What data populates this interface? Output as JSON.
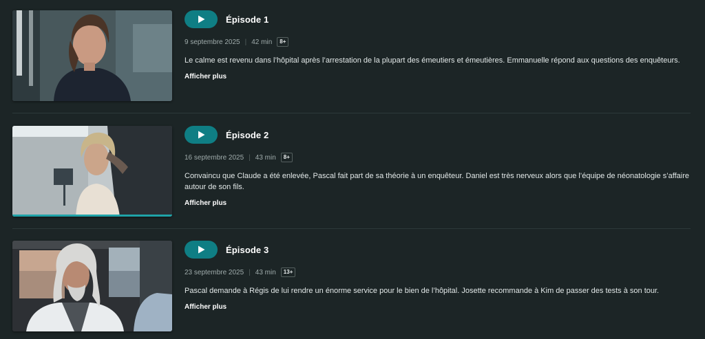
{
  "colors": {
    "background": "#1c2526",
    "accent": "#0f7e84",
    "progress": "#1fa3a8"
  },
  "episodes": [
    {
      "title": "Épisode 1",
      "date": "9 septembre 2025",
      "separator": "|",
      "duration": "42 min",
      "rating": "8+",
      "description": "Le calme est revenu dans l’hôpital après l’arrestation de la plupart des émeutiers et émeutières. Emmanuelle répond aux questions des enquêteurs.",
      "more_label": "Afficher plus",
      "play_icon": "play-icon",
      "watched_fraction": 0
    },
    {
      "title": "Épisode 2",
      "date": "16 septembre 2025",
      "separator": "|",
      "duration": "43 min",
      "rating": "8+",
      "description": "Convaincu que Claude a été enlevée, Pascal fait part de sa théorie à un enquêteur. Daniel est très nerveux alors que l’équipe de néonatologie s’affaire autour de son fils.",
      "more_label": "Afficher plus",
      "play_icon": "play-icon",
      "watched_fraction": 1.0
    },
    {
      "title": "Épisode 3",
      "date": "23 septembre 2025",
      "separator": "|",
      "duration": "43 min",
      "rating": "13+",
      "description": "Pascal demande à Régis de lui rendre un énorme service pour le bien de l’hôpital. Josette recommande à Kim de passer des tests à son tour.",
      "more_label": "Afficher plus",
      "play_icon": "play-icon",
      "watched_fraction": 0
    }
  ]
}
